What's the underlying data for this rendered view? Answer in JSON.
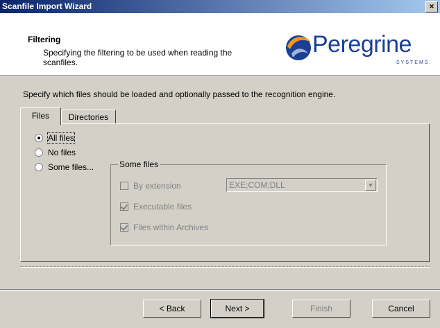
{
  "window": {
    "title": "Scanfile Import Wizard",
    "close_glyph": "×"
  },
  "header": {
    "title": "Filtering",
    "subtitle": "Specifying the filtering to be used when reading the scanfiles.",
    "logo_text": "Peregrine",
    "logo_sub": "SYSTEMS."
  },
  "instruction": "Specify which files should be loaded and optionally passed to the recognition engine.",
  "tabs": [
    {
      "label": "Files",
      "active": true
    },
    {
      "label": "Directories",
      "active": false
    }
  ],
  "radios": [
    {
      "label": "All files",
      "selected": true
    },
    {
      "label": "No files",
      "selected": false
    },
    {
      "label": "Some files...",
      "selected": false
    }
  ],
  "some_files_group": {
    "label": "Some files",
    "options": [
      {
        "label": "By extension",
        "checked": false
      },
      {
        "label": "Executable files",
        "checked": true
      },
      {
        "label": "Files within Archives",
        "checked": true
      }
    ],
    "extension_value": "EXE;COM;DLL"
  },
  "buttons": {
    "back": "< Back",
    "next": "Next >",
    "finish": "Finish",
    "cancel": "Cancel"
  },
  "colors": {
    "title_start": "#0a246a",
    "title_end": "#a6caf0",
    "logo_blue": "#1b3f95",
    "logo_orange": "#f7941d"
  }
}
